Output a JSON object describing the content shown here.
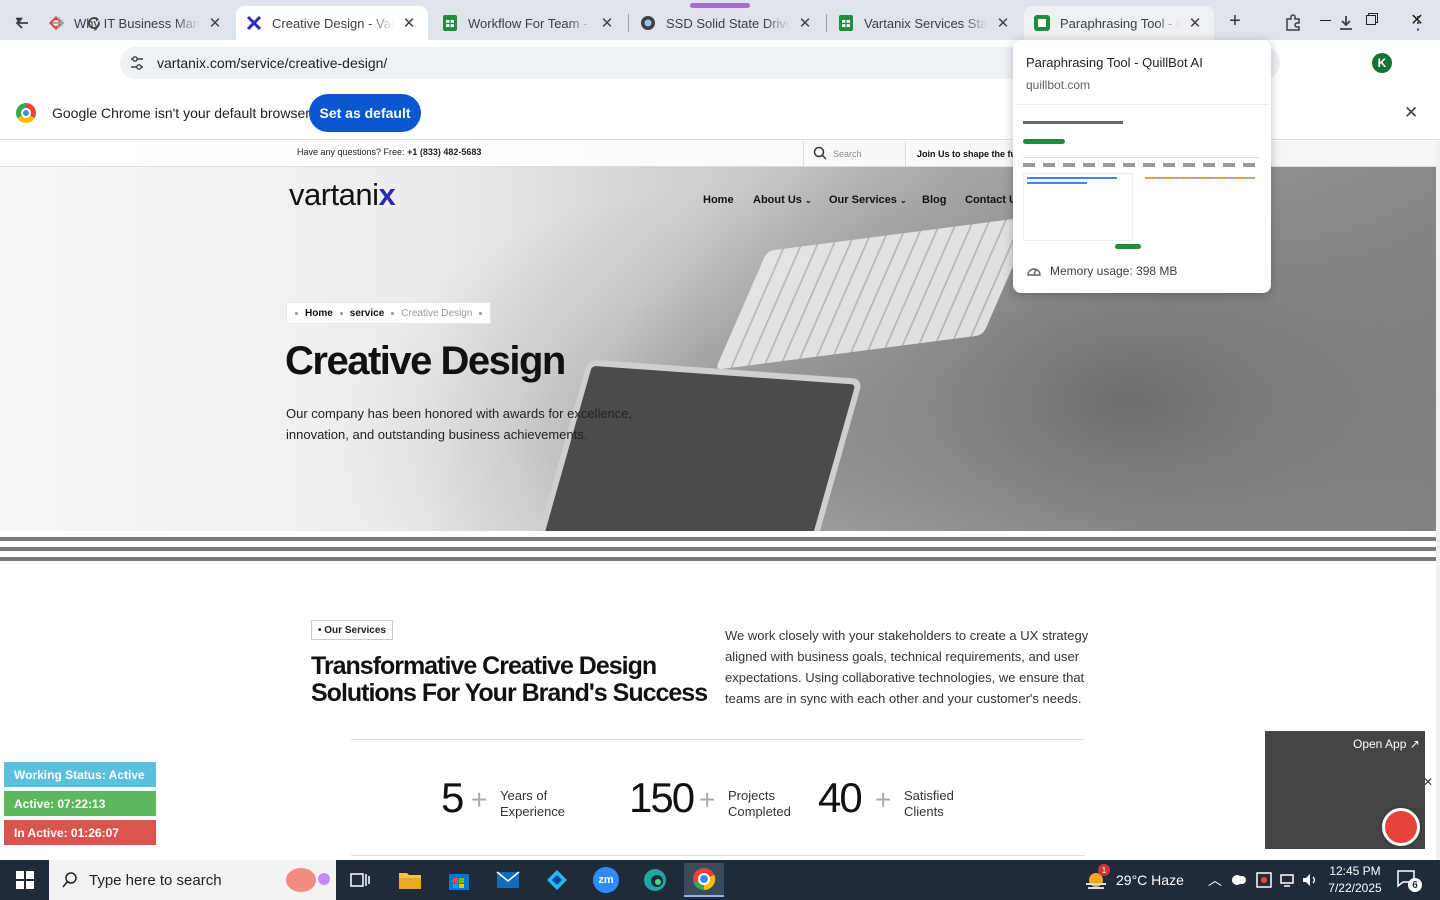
{
  "browser": {
    "tabs": [
      {
        "title": "Why IT Business Manag",
        "color": "#e8433a"
      },
      {
        "title": "Creative Design - Vartan",
        "color": "#2b2bb8"
      },
      {
        "title": "Workflow For Team - Go",
        "color": "#1e8e3e"
      },
      {
        "title": "SSD Solid State Drive Pr",
        "color": "#3c4043"
      },
      {
        "title": "Vartanix Services Stack",
        "color": "#1e8e3e"
      },
      {
        "title": "Paraphrasing Tool - Qui",
        "color": "#1e8e3e"
      }
    ],
    "new_tab": "+",
    "url": "vartanix.com/service/creative-design/",
    "avatar_letter": "K",
    "infobar_text": "Google Chrome isn't your default browser",
    "set_default_label": "Set as default"
  },
  "tab_popup": {
    "title": "Paraphrasing Tool - QuillBot AI",
    "domain": "quillbot.com",
    "memory": "Memory usage: 398 MB"
  },
  "site": {
    "question_prefix": "Have any questions? Free:",
    "phone": "+1 (833) 482-5683",
    "search_placeholder": "Search",
    "join_text": "Join Us to shape the fut",
    "logo_main": "vartani",
    "logo_x": "x",
    "nav": [
      "Home",
      "About Us",
      "Our Services",
      "Blog",
      "Contact U"
    ],
    "breadcrumb": [
      "Home",
      "service",
      "Creative Design"
    ],
    "hero_title": "Creative Design",
    "hero_text": "Our company has been honored with awards for excellence, innovation, and outstanding business achievements.",
    "services_tag": "Our Services",
    "services_title": "Transformative Creative Design Solutions For Your Brand's Success",
    "services_text": "We work closely with your stakeholders to create a UX strategy aligned with business goals, technical requirements, and user expectations. Using collaborative technologies, we ensure that teams are in sync with each other and your customer's needs.",
    "stats": [
      {
        "num": "5",
        "plus": "+",
        "line1": "Years of",
        "line2": "Experience"
      },
      {
        "num": "150",
        "plus": "+",
        "line1": "Projects",
        "line2": "Completed"
      },
      {
        "num": "40",
        "plus": "+",
        "line1": "Satisfied",
        "line2": "Clients"
      }
    ]
  },
  "widget": {
    "open_app": "Open App ↗",
    "working": "Working Status: Active",
    "active": "Active: 07:22:13",
    "inactive": "In Active: 01:26:07"
  },
  "taskbar": {
    "search_placeholder": "Type here to search",
    "weather": "29°C  Haze",
    "weather_badge": "1",
    "time": "12:45 PM",
    "date": "7/22/2025",
    "notif_count": "6",
    "zoom_label": "zm"
  },
  "colors": {
    "accent": "#0b57d0",
    "brand": "#2b2bb8",
    "working": "#5bc0de",
    "active": "#5cb85c",
    "inactive": "#d9534f"
  }
}
